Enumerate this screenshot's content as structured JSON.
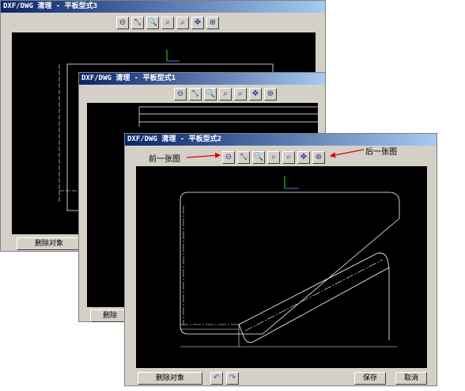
{
  "windows": {
    "w3": {
      "title": "DXF/DWG 清理 - 平板型式3",
      "delete_label": "删除对象"
    },
    "w1": {
      "title": "DXF/DWG 清理 - 平板型式1",
      "delete_label": "删除"
    },
    "w2": {
      "title": "DXF/DWG 清理 - 平板型式2",
      "delete_label": "删除对象",
      "save_label": "保存",
      "cancel_label": "取消"
    }
  },
  "toolbar_icons": {
    "prev": "⊖",
    "zoom_fit": "⤡",
    "zoom_in": "🔍",
    "zoom_window": "⌕",
    "zoom_prev": "⌕",
    "pan": "✥",
    "next": "⊕"
  },
  "undo_icon": "↶",
  "redo_icon": "↷",
  "annotations": {
    "prev_label": "前一张图",
    "next_label": "后一张图"
  },
  "colors": {
    "canvas": "#000000",
    "axis_green": "#00ff00",
    "axis_blue": "#4a7cff",
    "title_start": "#0a246a",
    "title_end": "#a6caf0"
  }
}
